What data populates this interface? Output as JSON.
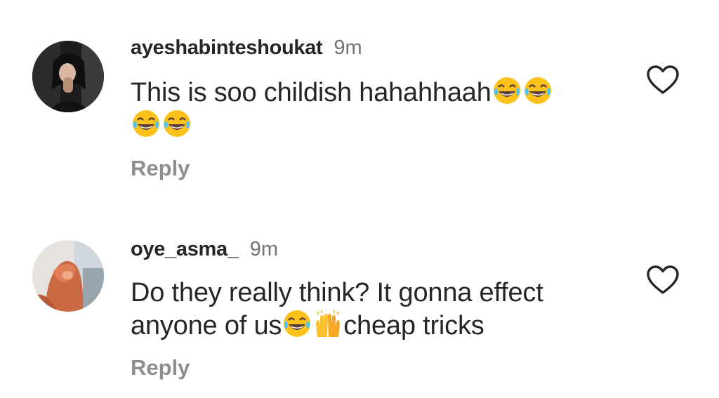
{
  "comments": [
    {
      "username": "ayeshabinteshoukat",
      "timestamp": "9m",
      "text_parts": [
        "This is soo childish hahahhaah"
      ],
      "emojis": [
        "face-with-tears-of-joy",
        "face-with-tears-of-joy",
        "face-with-tears-of-joy",
        "face-with-tears-of-joy"
      ],
      "reply_label": "Reply",
      "like_icon": "heart-outline-icon"
    },
    {
      "username": "oye_asma_",
      "timestamp": "9m",
      "text_parts": [
        "Do they really think? It gonna effect anyone of us",
        "cheap tricks"
      ],
      "emojis": [
        "face-with-tears-of-joy",
        "raising-hands"
      ],
      "reply_label": "Reply",
      "like_icon": "heart-outline-icon"
    }
  ],
  "colors": {
    "text": "#262626",
    "secondary": "#737373",
    "reply": "#8e8e8e",
    "background": "#ffffff"
  }
}
